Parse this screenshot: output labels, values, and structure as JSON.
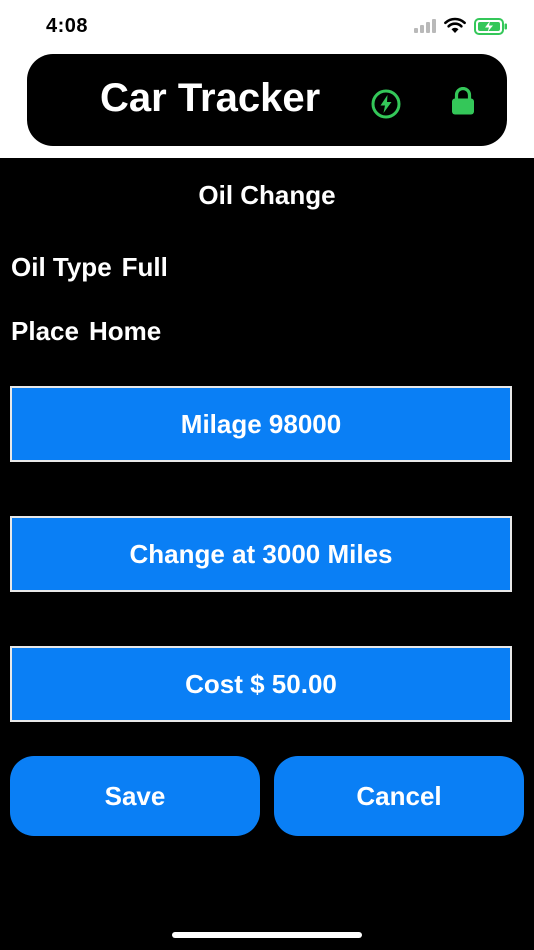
{
  "status": {
    "time": "4:08",
    "battery_color": "#34c759"
  },
  "header": {
    "title": "Car Tracker",
    "bolt_icon": "bolt-circle-icon",
    "lock_icon": "lock-icon",
    "accent": "#34c759"
  },
  "form": {
    "title": "Oil Change",
    "oil_type_label": "Oil Type",
    "oil_type_value": "Full",
    "place_label": "Place",
    "place_value": "Home",
    "milage_button": "Milage 98000",
    "change_button": "Change at 3000 Miles",
    "cost_button": "Cost $ 50.00"
  },
  "actions": {
    "save": "Save",
    "cancel": "Cancel",
    "button_color": "#0a7ff5"
  }
}
